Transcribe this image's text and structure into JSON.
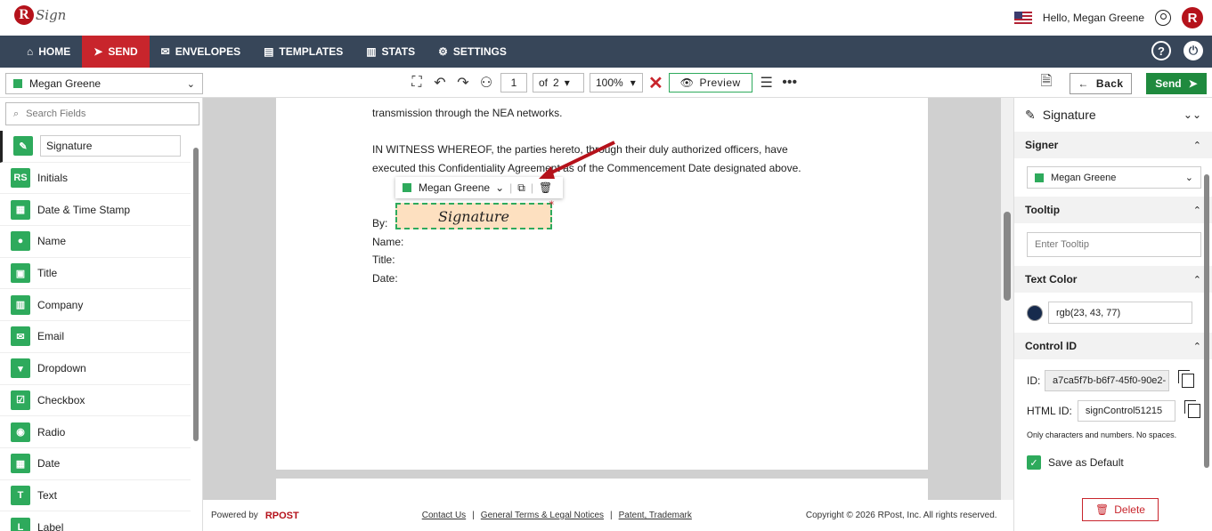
{
  "header": {
    "logo_text": "Sign",
    "greeting": "Hello, Megan Greene",
    "badge_letter": "R"
  },
  "nav": {
    "items": [
      {
        "label": "HOME",
        "icon": "home-icon"
      },
      {
        "label": "SEND",
        "icon": "send-icon",
        "active": true
      },
      {
        "label": "ENVELOPES",
        "icon": "envelope-icon"
      },
      {
        "label": "TEMPLATES",
        "icon": "template-icon"
      },
      {
        "label": "STATS",
        "icon": "stats-icon"
      },
      {
        "label": "SETTINGS",
        "icon": "gear-icon"
      }
    ],
    "help": "?",
    "power": "⏻"
  },
  "toolbar": {
    "signer": "Megan Greene",
    "page_current": "1",
    "page_of": "of",
    "page_total": "2",
    "zoom": "100%",
    "preview_label": "Preview",
    "back_label": "Back",
    "send_label": "Send"
  },
  "left_panel": {
    "search_placeholder": "Search Fields",
    "fields": [
      {
        "label": "Signature",
        "icon": "signature-icon",
        "glyph": "✎"
      },
      {
        "label": "Initials",
        "icon": "initials-icon",
        "glyph": "RS"
      },
      {
        "label": "Date & Time Stamp",
        "icon": "calendar-clock-icon",
        "glyph": "▦"
      },
      {
        "label": "Name",
        "icon": "person-icon",
        "glyph": "●"
      },
      {
        "label": "Title",
        "icon": "briefcase-icon",
        "glyph": "▣"
      },
      {
        "label": "Company",
        "icon": "building-icon",
        "glyph": "▥"
      },
      {
        "label": "Email",
        "icon": "email-icon",
        "glyph": "✉"
      },
      {
        "label": "Dropdown",
        "icon": "dropdown-icon",
        "glyph": "▾"
      },
      {
        "label": "Checkbox",
        "icon": "checkbox-icon",
        "glyph": "☑"
      },
      {
        "label": "Radio",
        "icon": "radio-icon",
        "glyph": "◉"
      },
      {
        "label": "Date",
        "icon": "calendar-icon",
        "glyph": "▦"
      },
      {
        "label": "Text",
        "icon": "text-icon",
        "glyph": "T"
      },
      {
        "label": "Label",
        "icon": "label-icon",
        "glyph": "L"
      }
    ]
  },
  "document": {
    "line1": "transmission through the NEA networks.",
    "line2": "IN WITNESS WHEREOF, the parties hereto, through their duly authorized officers, have",
    "line3": "executed this Confidentiality Agreement as of the Commencement Date designated above.",
    "by": "By:",
    "name": "Name:",
    "title": "Title:",
    "date": "Date:",
    "field_signer": "Megan Greene",
    "field_label": "Signature",
    "required_mark": "*"
  },
  "footer": {
    "powered_by": "Powered by",
    "brand": "RPOST",
    "contact": "Contact Us",
    "terms": "General Terms & Legal Notices",
    "patent": "Patent, Trademark",
    "copyright": "Copyright © 2026 RPost, Inc. All rights reserved."
  },
  "properties": {
    "title": "Signature",
    "signer_section": "Signer",
    "signer_value": "Megan Greene",
    "tooltip_section": "Tooltip",
    "tooltip_placeholder": "Enter Tooltip",
    "color_section": "Text Color",
    "color_value": "rgb(23, 43, 77)",
    "color_hex": "#172b4d",
    "control_section": "Control ID",
    "id_label": "ID:",
    "id_value": "a7ca5f7b-b6f7-45f0-90e2-",
    "html_id_label": "HTML ID:",
    "html_id_value": "signControl51215",
    "hint": "Only characters and numbers. No spaces.",
    "save_default": "Save as Default",
    "delete_label": "Delete"
  },
  "colors": {
    "nav_bg": "#374659",
    "accent_red": "#c8252c",
    "accent_green": "#2eaa5c"
  }
}
